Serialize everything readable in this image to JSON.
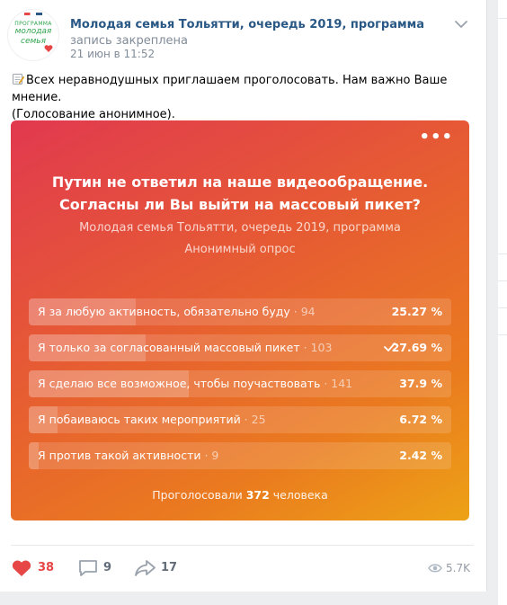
{
  "post": {
    "group_name": "Молодая семья Тольятти, очередь 2019, программа",
    "pinned_text": " запись закреплена",
    "date": "21 июн в 11:52",
    "avatar": {
      "line1": "ПРОГРАММА",
      "line2": "молодая",
      "line3": "семья"
    },
    "text_line1": "Всех неравнодушных приглашаем проголосовать. Нам важно Ваше мнение.",
    "text_line2": "(Голосование анонимное)."
  },
  "poll": {
    "question": "Путин не ответил на наше видеообращение. Согласны ли Вы выйти на массовый пикет?",
    "author": "Молодая семья Тольятти, очередь 2019, программа",
    "type": "Анонимный опрос",
    "more_label": "•••",
    "answers": [
      {
        "text": "Я за любую активность, обязательно буду",
        "count": " · 94",
        "percent_label": "25.27 %",
        "percent": 25.27,
        "voted": false
      },
      {
        "text": "Я только за согласованный массовый пикет",
        "count": " · 103",
        "percent_label": "27.69 %",
        "percent": 27.69,
        "voted": true
      },
      {
        "text": "Я сделаю все возможное, чтобы поучаствовать",
        "count": " · 141",
        "percent_label": "37.9 %",
        "percent": 37.9,
        "voted": false
      },
      {
        "text": "Я побаиваюсь таких мероприятий",
        "count": " · 25",
        "percent_label": "6.72 %",
        "percent": 6.72,
        "voted": false
      },
      {
        "text": "Я против такой активности",
        "count": " · 9",
        "percent_label": "2.42 %",
        "percent": 2.42,
        "voted": false
      }
    ],
    "total_prefix": "Проголосовали ",
    "total_count": "372",
    "total_suffix": " человека"
  },
  "footer": {
    "likes": "38",
    "comments": "9",
    "shares": "17",
    "views": "5.7K"
  },
  "colors": {
    "link": "#2a5885",
    "like": "#e64646",
    "muted": "#818c99",
    "poll_gradient_start": "#e1394f",
    "poll_gradient_end": "#eda216"
  },
  "icons": [
    "memo-icon",
    "more-icon",
    "check-icon",
    "heart-icon",
    "comment-icon",
    "share-icon",
    "eye-icon",
    "chevron-down-icon"
  ]
}
